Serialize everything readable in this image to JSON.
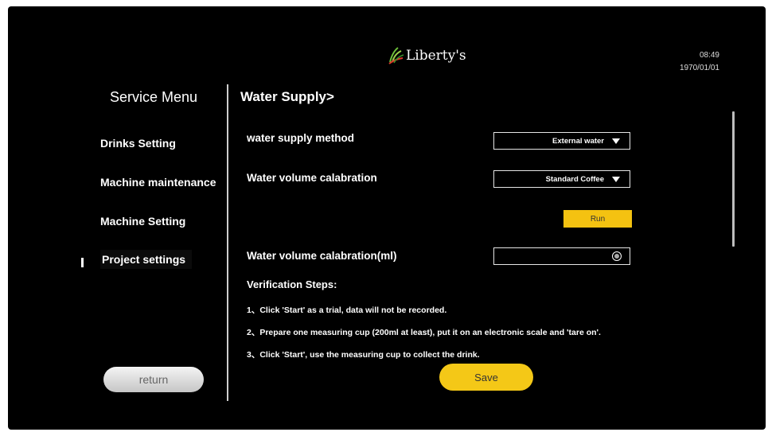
{
  "header": {
    "logo_text": "Liberty's",
    "time": "08:49",
    "date": "1970/01/01"
  },
  "sidebar": {
    "title": "Service Menu",
    "items": [
      {
        "label": "Drinks Setting"
      },
      {
        "label": "Machine maintenance"
      },
      {
        "label": "Machine Setting"
      },
      {
        "label": "Project settings",
        "active": true
      }
    ],
    "return_label": "return"
  },
  "main": {
    "page_title": "Water Supply>",
    "water_supply_method": {
      "label": "water supply method",
      "value": "External water"
    },
    "water_volume_calibration": {
      "label": "Water volume calabration",
      "value": "Standard Coffee"
    },
    "run_label": "Run",
    "water_volume_ml": {
      "label": "Water volume calabration(ml)",
      "value": ""
    },
    "verification": {
      "title": "Verification Steps:",
      "steps": [
        "1、Click 'Start' as a trial, data will not be recorded.",
        "2、Prepare one measuring cup (200ml at least), put it on an electronic scale and 'tare on'.",
        "3、Click 'Start', use the measuring cup to collect the drink."
      ]
    },
    "save_label": "Save"
  },
  "colors": {
    "background": "#000000",
    "accent": "#f4c211",
    "text": "#ffffff"
  }
}
